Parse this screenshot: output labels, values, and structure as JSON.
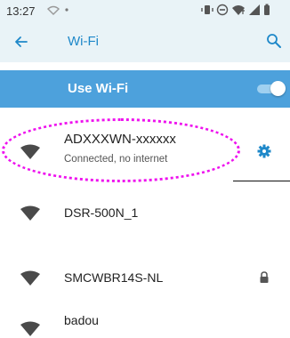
{
  "status_bar": {
    "time": "13:27",
    "icons": [
      "sim-status-icon",
      "dot-icon",
      "vibrate-icon",
      "do-not-disturb-icon",
      "wifi-signal-icon",
      "cell-signal-icon",
      "battery-icon"
    ]
  },
  "app_bar": {
    "title": "Wi-Fi",
    "back_icon": "arrow-left-icon",
    "search_icon": "search-icon"
  },
  "use_wifi": {
    "label": "Use Wi-Fi",
    "enabled": true
  },
  "networks": [
    {
      "name": "ADXXXWN-xxxxxx",
      "status": "Connected, no internet",
      "icon": "wifi-icon",
      "action_icon": "gear-icon"
    },
    {
      "name": "DSR-500N_1",
      "icon": "wifi-icon"
    },
    {
      "name": "SMCWBR14S-NL",
      "icon": "wifi-icon",
      "secured_icon": "lock-icon"
    },
    {
      "name": "badou",
      "icon": "wifi-icon"
    }
  ],
  "colors": {
    "accent": "#1e88c9",
    "header_bg": "#e9f3f7",
    "use_wifi_bg": "#4da1dc",
    "highlight_annotation": "#ee11ee"
  }
}
